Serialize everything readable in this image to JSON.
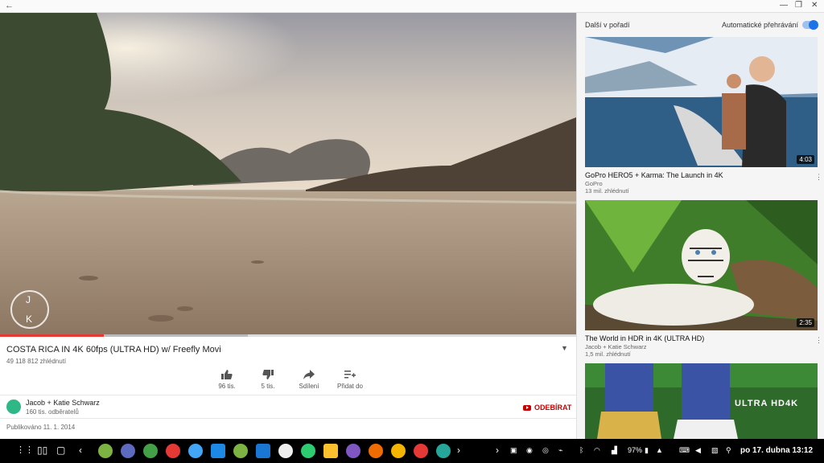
{
  "window": {
    "back_icon": "back-arrow-icon"
  },
  "player": {
    "progress_fraction": 0.18,
    "buffer_fraction": 0.43,
    "watermark_letters": [
      "J",
      "K"
    ]
  },
  "video": {
    "title": "COSTA RICA IN 4K 60fps (ULTRA HD) w/ Freefly Movi",
    "views": "49 118 812 zhlédnutí"
  },
  "actions": {
    "like": "96 tis.",
    "dislike": "5 tis.",
    "share": "Sdílení",
    "add": "Přidat do"
  },
  "channel": {
    "name": "Jacob + Katie Schwarz",
    "subscribers": "160 tis. odběratelů",
    "subscribe_label": "ODEBÍRAT"
  },
  "published": "Publikováno 11. 1. 2014",
  "sidebar": {
    "up_next": "Další v pořadí",
    "autoplay": "Automatické přehrávání",
    "autoplay_on": true,
    "videos": [
      {
        "title": "GoPro HERO5 + Karma: The Launch in 4K",
        "channel": "GoPro",
        "views": "13 mil. zhlédnutí",
        "duration": "4:03"
      },
      {
        "title": "The World in HDR in 4K (ULTRA HD)",
        "channel": "Jacob + Katie Schwarz",
        "views": "1,5 mil. zhlédnutí",
        "duration": "2:35"
      },
      {
        "title": "",
        "channel": "",
        "views": "",
        "duration": "",
        "overlay": "ULTRA HD4K"
      }
    ]
  },
  "taskbar": {
    "battery": "97%",
    "clock": "po 17. dubna 13:12"
  }
}
